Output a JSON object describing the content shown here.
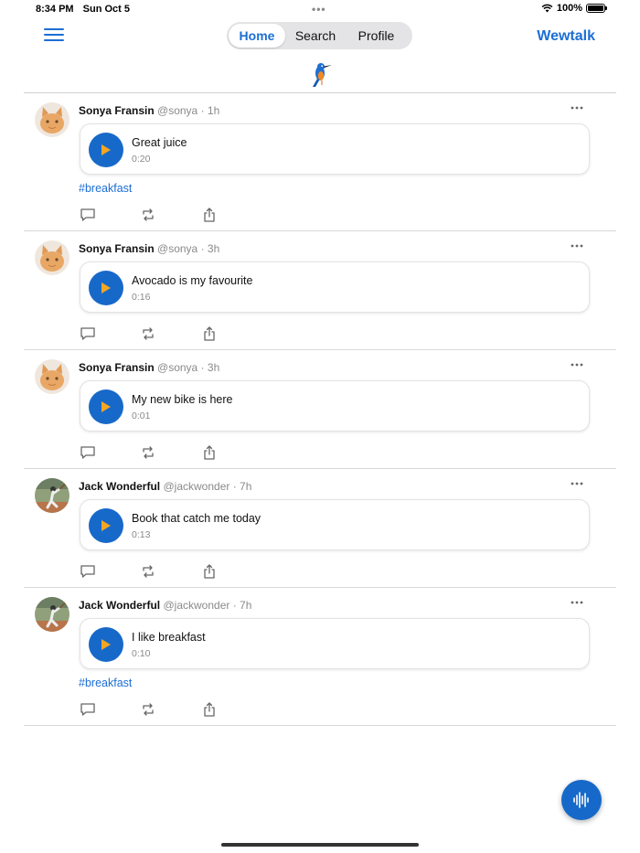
{
  "status_bar": {
    "time": "8:34 PM",
    "date": "Sun Oct 5",
    "battery": "100%",
    "battery_level": 1.0
  },
  "nav": {
    "tabs": [
      {
        "label": "Home",
        "active": true
      },
      {
        "label": "Search",
        "active": false
      },
      {
        "label": "Profile",
        "active": false
      }
    ],
    "brand": "Wewtalk"
  },
  "colors": {
    "accent": "#1c6ed4",
    "play_button": "#1769c9",
    "play_triangle": "#f5a623"
  },
  "posts": [
    {
      "author": "Sonya Fransin",
      "meta": "@sonya · 1h",
      "audio_title": "Great juice",
      "duration": "0:20",
      "hashtag": "#breakfast",
      "avatar": "cat-avatar"
    },
    {
      "author": "Sonya Fransin",
      "meta": "@sonya · 3h",
      "audio_title": "Avocado is my favourite",
      "duration": "0:16",
      "hashtag": "",
      "avatar": "cat-avatar"
    },
    {
      "author": "Sonya Fransin",
      "meta": "@sonya · 3h",
      "audio_title": "My new bike is here",
      "duration": "0:01",
      "hashtag": "",
      "avatar": "cat-avatar"
    },
    {
      "author": "Jack Wonderful",
      "meta": "@jackwonder · 7h",
      "audio_title": "Book that catch me today",
      "duration": "0:13",
      "hashtag": "",
      "avatar": "baseball-avatar"
    },
    {
      "author": "Jack Wonderful",
      "meta": "@jackwonder · 7h",
      "audio_title": "I like breakfast",
      "duration": "0:10",
      "hashtag": "#breakfast",
      "avatar": "baseball-avatar"
    }
  ],
  "icons": {
    "menu": "hamburger-menu-icon",
    "logo": "kingfisher-logo-icon",
    "more": "more-dots-icon",
    "play": "play-icon",
    "comment": "comment-icon",
    "repost": "repost-icon",
    "share": "share-icon",
    "record": "audio-wave-icon"
  }
}
